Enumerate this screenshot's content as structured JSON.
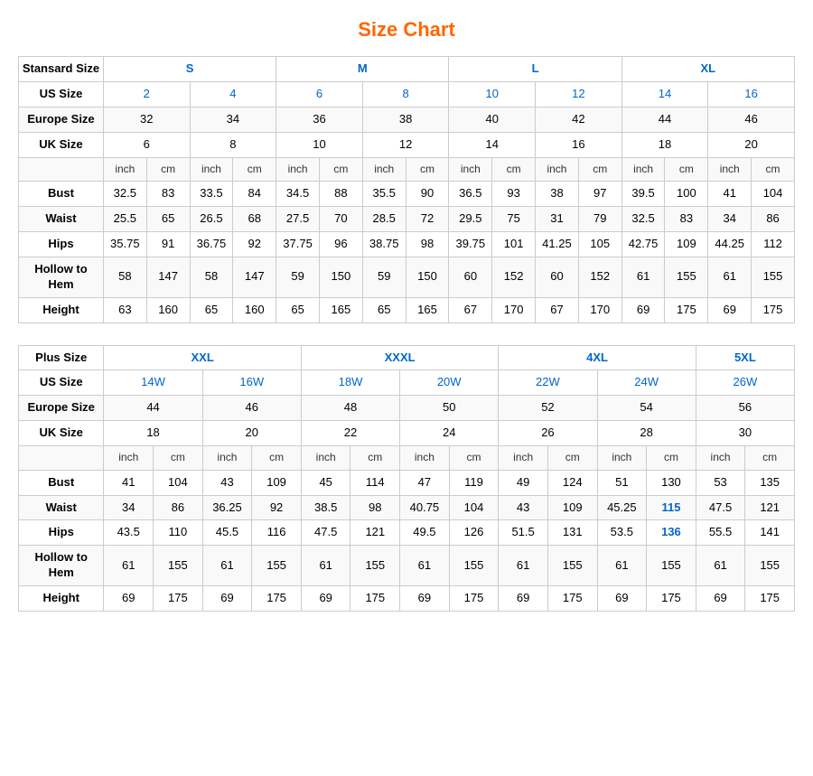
{
  "title": "Size Chart",
  "standard_table": {
    "headers": {
      "col1": "Stansard Size",
      "s": "S",
      "m": "M",
      "l": "L",
      "xl": "XL"
    },
    "us_size": {
      "label": "US Size",
      "values": [
        "2",
        "4",
        "6",
        "8",
        "10",
        "12",
        "14",
        "16"
      ]
    },
    "europe_size": {
      "label": "Europe Size",
      "values": [
        "32",
        "34",
        "36",
        "38",
        "40",
        "42",
        "44",
        "46"
      ]
    },
    "uk_size": {
      "label": "UK Size",
      "values": [
        "6",
        "8",
        "10",
        "12",
        "14",
        "16",
        "18",
        "20"
      ]
    },
    "inch_cm": [
      "inch",
      "cm",
      "inch",
      "cm",
      "inch",
      "cm",
      "inch",
      "cm",
      "inch",
      "cm",
      "inch",
      "cm",
      "inch",
      "cm",
      "inch",
      "cm"
    ],
    "bust": {
      "label": "Bust",
      "values": [
        "32.5",
        "83",
        "33.5",
        "84",
        "34.5",
        "88",
        "35.5",
        "90",
        "36.5",
        "93",
        "38",
        "97",
        "39.5",
        "100",
        "41",
        "104"
      ]
    },
    "waist": {
      "label": "Waist",
      "values": [
        "25.5",
        "65",
        "26.5",
        "68",
        "27.5",
        "70",
        "28.5",
        "72",
        "29.5",
        "75",
        "31",
        "79",
        "32.5",
        "83",
        "34",
        "86"
      ]
    },
    "hips": {
      "label": "Hips",
      "values": [
        "35.75",
        "91",
        "36.75",
        "92",
        "37.75",
        "96",
        "38.75",
        "98",
        "39.75",
        "101",
        "41.25",
        "105",
        "42.75",
        "109",
        "44.25",
        "112"
      ]
    },
    "hollow_to_hem": {
      "label": "Hollow to Hem",
      "values": [
        "58",
        "147",
        "58",
        "147",
        "59",
        "150",
        "59",
        "150",
        "60",
        "152",
        "60",
        "152",
        "61",
        "155",
        "61",
        "155"
      ]
    },
    "height": {
      "label": "Height",
      "values": [
        "63",
        "160",
        "65",
        "160",
        "65",
        "165",
        "65",
        "165",
        "67",
        "170",
        "67",
        "170",
        "69",
        "175",
        "69",
        "175"
      ]
    }
  },
  "plus_table": {
    "headers": {
      "col1": "Plus Size",
      "xxl": "XXL",
      "xxxl": "XXXL",
      "4xl": "4XL",
      "5xl": "5XL"
    },
    "us_size": {
      "label": "US Size",
      "values": [
        "14W",
        "16W",
        "18W",
        "20W",
        "22W",
        "24W",
        "26W"
      ]
    },
    "europe_size": {
      "label": "Europe Size",
      "values": [
        "44",
        "46",
        "48",
        "50",
        "52",
        "54",
        "56"
      ]
    },
    "uk_size": {
      "label": "UK Size",
      "values": [
        "18",
        "20",
        "22",
        "24",
        "26",
        "28",
        "30"
      ]
    },
    "inch_cm": [
      "inch",
      "cm",
      "inch",
      "cm",
      "inch",
      "cm",
      "inch",
      "cm",
      "inch",
      "cm",
      "inch",
      "cm",
      "inch",
      "cm"
    ],
    "bust": {
      "label": "Bust",
      "values": [
        "41",
        "104",
        "43",
        "109",
        "45",
        "114",
        "47",
        "119",
        "49",
        "124",
        "51",
        "130",
        "53",
        "135"
      ]
    },
    "waist": {
      "label": "Waist",
      "values": [
        "34",
        "86",
        "36.25",
        "92",
        "38.5",
        "98",
        "40.75",
        "104",
        "43",
        "109",
        "45.25",
        "115",
        "47.5",
        "121"
      ]
    },
    "hips": {
      "label": "Hips",
      "values": [
        "43.5",
        "110",
        "45.5",
        "116",
        "47.5",
        "121",
        "49.5",
        "126",
        "51.5",
        "131",
        "53.5",
        "136",
        "55.5",
        "141"
      ]
    },
    "hollow_to_hem": {
      "label": "Hollow to Hem",
      "values": [
        "61",
        "155",
        "61",
        "155",
        "61",
        "155",
        "61",
        "155",
        "61",
        "155",
        "61",
        "155",
        "61",
        "155"
      ]
    },
    "height": {
      "label": "Height",
      "values": [
        "69",
        "175",
        "69",
        "175",
        "69",
        "175",
        "69",
        "175",
        "69",
        "175",
        "69",
        "175",
        "69",
        "175"
      ]
    }
  }
}
